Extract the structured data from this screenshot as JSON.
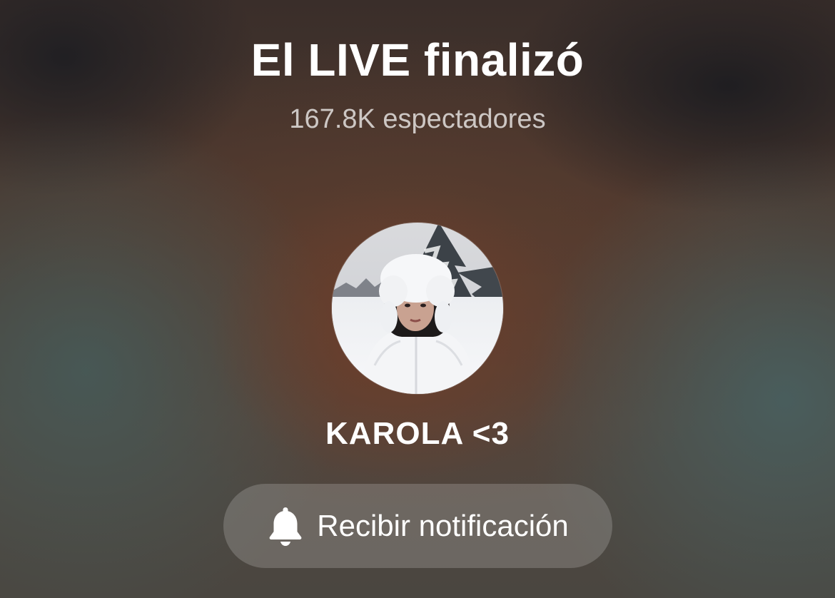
{
  "live_end": {
    "title": "El LIVE finalizó",
    "viewers_text": "167.8K espectadores"
  },
  "profile": {
    "avatar_icon": "profile-photo",
    "username": "KAROLA <3"
  },
  "notify_button": {
    "icon": "bell-icon",
    "label": "Recibir notificación"
  }
}
